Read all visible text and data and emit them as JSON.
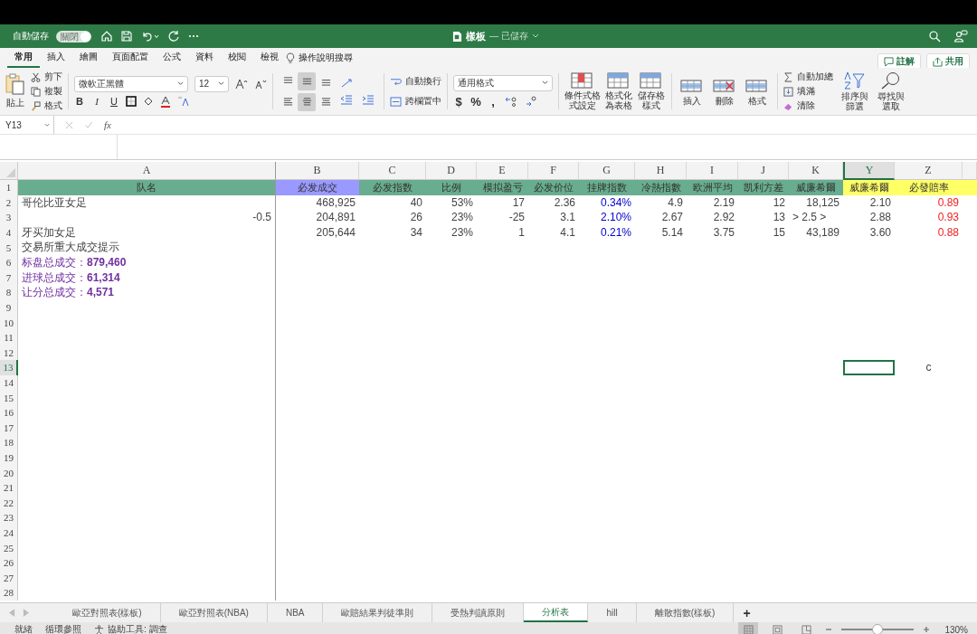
{
  "title_bar": {
    "autosave_label": "自動儲存",
    "autosave_toggle": {
      "label": "關閉",
      "on": false
    },
    "title": "樣板",
    "status": "— 已儲存"
  },
  "ribbon_tabs": [
    {
      "label": "常用",
      "selected": true
    },
    {
      "label": "插入",
      "selected": false
    },
    {
      "label": "繪圖",
      "selected": false
    },
    {
      "label": "頁面配置",
      "selected": false
    },
    {
      "label": "公式",
      "selected": false
    },
    {
      "label": "資料",
      "selected": false
    },
    {
      "label": "校閱",
      "selected": false
    },
    {
      "label": "檢視",
      "selected": false
    }
  ],
  "tell_me": "操作說明搜尋",
  "actions": [
    "註解",
    "共用"
  ],
  "clipboard": {
    "paste": "貼上",
    "items": [
      "剪下",
      "複製",
      "格式"
    ]
  },
  "font": {
    "family": "微軟正黑體",
    "size": "12"
  },
  "format_buttons": [
    "B",
    "I",
    "U"
  ],
  "align_buttons": [
    {
      "selected": false
    },
    {
      "selected": true
    },
    {
      "selected": false
    },
    {
      "selected": false
    },
    {
      "selected": true
    },
    {
      "selected": false
    }
  ],
  "wrap": [
    "自動換行",
    "跨欄置中"
  ],
  "number_format": "通用格式",
  "number_buttons": [
    "$",
    "%",
    ","
  ],
  "styles": [
    "條件式格式設定",
    "格式化為表格",
    "儲存格樣式"
  ],
  "cells_group": [
    "插入",
    "刪除",
    "格式"
  ],
  "editing": {
    "items": [
      "自動加總",
      "填滿",
      "清除"
    ],
    "big": [
      "排序與篩選",
      "尋找與選取"
    ]
  },
  "formula_bar": {
    "name_box": "Y13",
    "fx": "fx"
  },
  "sheet": {
    "columns": [
      {
        "letter": "A",
        "selected": false
      },
      {
        "letter": "B",
        "selected": false
      },
      {
        "letter": "C",
        "selected": false
      },
      {
        "letter": "D",
        "selected": false
      },
      {
        "letter": "E",
        "selected": false
      },
      {
        "letter": "F",
        "selected": false
      },
      {
        "letter": "G",
        "selected": false
      },
      {
        "letter": "H",
        "selected": false
      },
      {
        "letter": "I",
        "selected": false
      },
      {
        "letter": "J",
        "selected": false
      },
      {
        "letter": "K",
        "selected": false
      },
      {
        "letter": "Y",
        "selected": true
      },
      {
        "letter": "Z",
        "selected": false
      }
    ],
    "rows": [
      {
        "number": "1",
        "selected": false,
        "cells": [
          {
            "text": "队名",
            "kind": "header",
            "color": "#68ad8f"
          },
          {
            "text": "必发成交",
            "kind": "header",
            "color": "#9999ff"
          },
          {
            "text": "必发指数",
            "kind": "header",
            "color": "#68ad8f"
          },
          {
            "text": "比例",
            "kind": "header",
            "color": "#68ad8f"
          },
          {
            "text": "模拟盈亏",
            "kind": "header",
            "color": "#68ad8f"
          },
          {
            "text": "必发价位",
            "kind": "header",
            "color": "#68ad8f"
          },
          {
            "text": "挂牌指数",
            "kind": "header",
            "color": "#68ad8f"
          },
          {
            "text": "冷熱指數",
            "kind": "header",
            "color": "#68ad8f"
          },
          {
            "text": "欧洲平均",
            "kind": "header",
            "color": "#68ad8f"
          },
          {
            "text": "凯利方差",
            "kind": "header",
            "color": "#68ad8f"
          },
          {
            "text": "威廉希爾",
            "kind": "header",
            "color": "#68ad8f"
          },
          {
            "text": "威廉希爾",
            "kind": "header",
            "color": "#ffff66"
          },
          {
            "text": "必發賠率",
            "kind": "header",
            "color": "#ffff66"
          },
          {
            "kind": "header",
            "color": "#ffff66"
          }
        ]
      },
      {
        "number": "2",
        "selected": false,
        "cells": [
          {
            "text": "哥伦比亚女足",
            "kind": "text"
          },
          {
            "text": "468,925",
            "kind": "number"
          },
          {
            "text": "40",
            "kind": "number"
          },
          {
            "text": "53%",
            "kind": "number"
          },
          {
            "text": "17",
            "kind": "number"
          },
          {
            "text": "2.36",
            "kind": "number"
          },
          {
            "text": "0.34%",
            "kind": "number",
            "color": "#0000cc"
          },
          {
            "text": "4.9",
            "kind": "number"
          },
          {
            "text": "2.19",
            "kind": "number"
          },
          {
            "text": "12",
            "kind": "number"
          },
          {
            "text": "18,125",
            "kind": "number"
          },
          {
            "text": "2.10",
            "kind": "number"
          },
          {
            "text": "0.89",
            "kind": "number",
            "color": "#ee2222"
          }
        ]
      },
      {
        "number": "3",
        "selected": false,
        "cells": [
          {
            "text": "-0.5",
            "kind": "number"
          },
          {
            "text": "204,891",
            "kind": "number"
          },
          {
            "text": "26",
            "kind": "number"
          },
          {
            "text": "23%",
            "kind": "number"
          },
          {
            "text": "-25",
            "kind": "number"
          },
          {
            "text": "3.1",
            "kind": "number"
          },
          {
            "text": "2.10%",
            "kind": "number",
            "color": "#0000cc"
          },
          {
            "text": "2.67",
            "kind": "number"
          },
          {
            "text": "2.92",
            "kind": "number"
          },
          {
            "text": "13",
            "kind": "number"
          },
          {
            "text": "> 2.5 >",
            "kind": "text"
          },
          {
            "text": "2.88",
            "kind": "number"
          },
          {
            "text": "0.93",
            "kind": "number",
            "color": "#ee2222"
          }
        ]
      },
      {
        "number": "4",
        "selected": false,
        "cells": [
          {
            "text": "牙买加女足",
            "kind": "text"
          },
          {
            "text": "205,644",
            "kind": "number"
          },
          {
            "text": "34",
            "kind": "number"
          },
          {
            "text": "23%",
            "kind": "number"
          },
          {
            "text": "1",
            "kind": "number"
          },
          {
            "text": "4.1",
            "kind": "number"
          },
          {
            "text": "0.21%",
            "kind": "number",
            "color": "#0000cc"
          },
          {
            "text": "5.14",
            "kind": "number"
          },
          {
            "text": "3.75",
            "kind": "number"
          },
          {
            "text": "15",
            "kind": "number"
          },
          {
            "text": "43,189",
            "kind": "number"
          },
          {
            "text": "3.60",
            "kind": "number"
          },
          {
            "text": "0.88",
            "kind": "number",
            "color": "#ee2222"
          }
        ]
      },
      {
        "number": "5",
        "selected": false,
        "cells": [
          {
            "text": "交易所重大成交提示",
            "kind": "text"
          }
        ]
      },
      {
        "number": "6",
        "selected": false,
        "cells": [
          {
            "text": "标盘总成交：**879,460**",
            "kind": "text",
            "color": "#7030a0"
          }
        ]
      },
      {
        "number": "7",
        "selected": false,
        "cells": [
          {
            "text": "进球总成交：**61,314**",
            "kind": "text",
            "color": "#7030a0"
          }
        ]
      },
      {
        "number": "8",
        "selected": false,
        "cells": [
          {
            "text": "让分总成交：**4,571**",
            "kind": "text",
            "color": "#7030a0"
          }
        ]
      },
      {
        "number": "9",
        "selected": false
      },
      {
        "number": "10",
        "selected": false
      },
      {
        "number": "11",
        "selected": false
      },
      {
        "number": "12",
        "selected": false
      },
      {
        "number": "13",
        "selected": true,
        "cells": [
          {},
          {},
          {},
          {},
          {},
          {},
          {},
          {},
          {},
          {},
          {},
          {},
          {
            "text": "c",
            "kind": "center"
          }
        ]
      },
      {
        "number": "14",
        "selected": false
      },
      {
        "number": "15",
        "selected": false
      },
      {
        "number": "16",
        "selected": false
      },
      {
        "number": "17",
        "selected": false
      },
      {
        "number": "18",
        "selected": false
      },
      {
        "number": "19",
        "selected": false
      },
      {
        "number": "20",
        "selected": false
      },
      {
        "number": "21",
        "selected": false
      },
      {
        "number": "22",
        "selected": false
      },
      {
        "number": "23",
        "selected": false
      },
      {
        "number": "24",
        "selected": false
      },
      {
        "number": "25",
        "selected": false
      },
      {
        "number": "26",
        "selected": false
      },
      {
        "number": "27",
        "selected": false
      },
      {
        "number": "28",
        "selected": false
      }
    ]
  },
  "sheet_tabs": [
    {
      "label": "歐亞對照表(樣板)",
      "selected": false
    },
    {
      "label": "歐亞對照表(NBA)",
      "selected": false
    },
    {
      "label": "NBA",
      "selected": false
    },
    {
      "label": "歐賠結果判徒準則",
      "selected": false
    },
    {
      "label": "受熱判讀原則",
      "selected": false
    },
    {
      "label": "分析表",
      "selected": true
    },
    {
      "label": "hill",
      "selected": false
    },
    {
      "label": "離散指數(樣板)",
      "selected": false
    }
  ],
  "add_sheet": "+",
  "status_bar": {
    "items": [
      "就緒",
      "循環參照"
    ],
    "accessibility": "協助工具: 調查",
    "views": [
      {
        "selected": true
      },
      {
        "selected": false
      },
      {
        "selected": false
      }
    ],
    "zoom": {
      "level": 0.5,
      "reading": "130%"
    }
  }
}
